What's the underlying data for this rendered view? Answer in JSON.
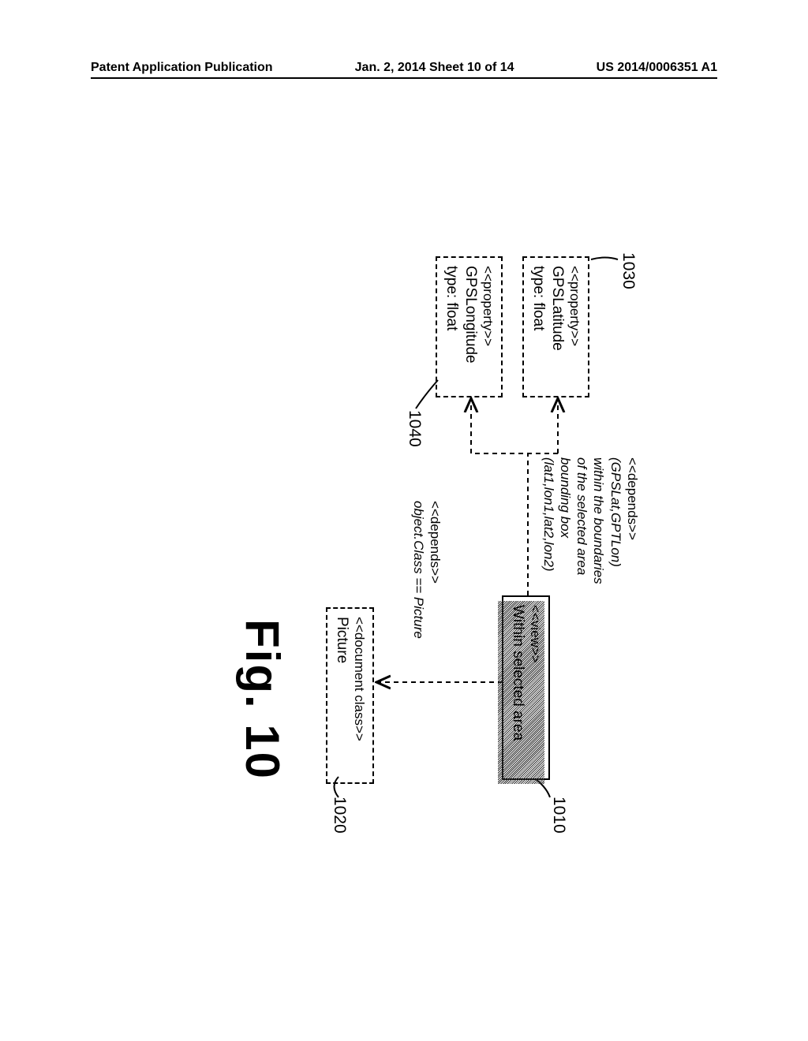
{
  "header": {
    "left": "Patent Application Publication",
    "center": "Jan. 2, 2014   Sheet 10 of 14",
    "right": "US 2014/0006351 A1"
  },
  "boxes": {
    "view": {
      "stereo": "<<view>>",
      "title": "Within selected area"
    },
    "docclass": {
      "stereo": "<<document class>>",
      "title": "Picture"
    },
    "latitude": {
      "stereo": "<<property>>",
      "title": "GPSLatitude",
      "type": "type: float"
    },
    "longitude": {
      "stereo": "<<property>>",
      "title": "GPSLongitude",
      "type": "type: float"
    }
  },
  "deps": {
    "class": {
      "stereo": "<<depends>>",
      "text": "object.Class == Picture"
    },
    "coords": {
      "stereo": "<<depends>>",
      "line1": "(GPSLat,GPTLon)",
      "line2": "within the boundaries",
      "line3": "of the selected area",
      "line4": "bounding box",
      "line5": "(lat1,lon1,lat2,lon2)"
    }
  },
  "refs": {
    "view": "1010",
    "docclass": "1020",
    "latitude": "1030",
    "longitude": "1040"
  },
  "figure_label": "Fig. 10"
}
